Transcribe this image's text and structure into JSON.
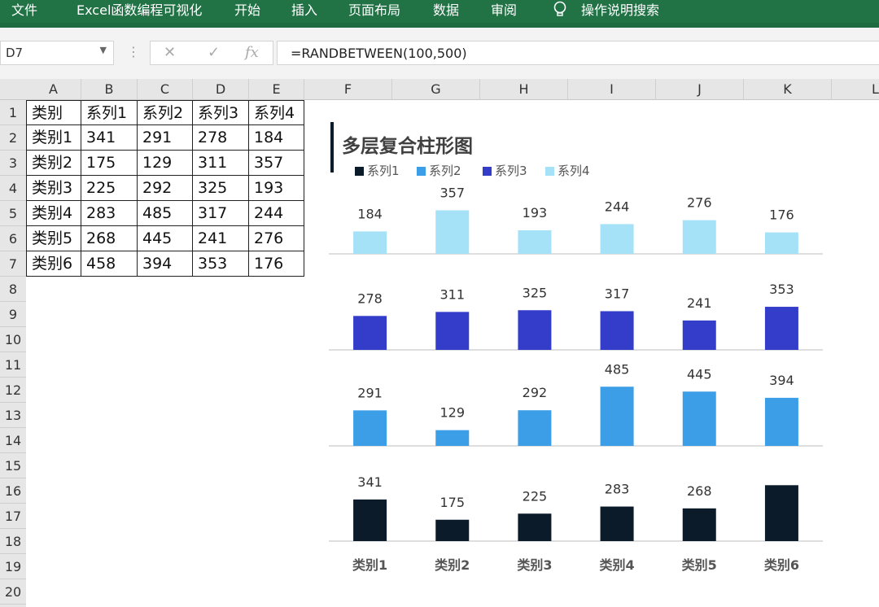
{
  "ribbon": {
    "tabs": [
      "文件",
      "Excel函数编程可视化",
      "开始",
      "插入",
      "页面布局",
      "数据",
      "审阅",
      "操作说明搜索"
    ]
  },
  "formula_bar": {
    "name_box": "D7",
    "cancel_icon": "✕",
    "enter_icon": "✓",
    "fx_label": "fx",
    "formula": "=RANDBETWEEN(100,500)"
  },
  "columns": [
    "A",
    "B",
    "C",
    "D",
    "E",
    "F",
    "G",
    "H",
    "I",
    "J",
    "K",
    "L"
  ],
  "rows": [
    "1",
    "2",
    "3",
    "4",
    "5",
    "6",
    "7",
    "8",
    "9",
    "10",
    "11",
    "12",
    "13",
    "14",
    "15",
    "16",
    "17",
    "18",
    "19",
    "20"
  ],
  "table": {
    "header": [
      "类别",
      "系列1",
      "系列2",
      "系列3",
      "系列4"
    ],
    "rows": [
      [
        "类别1",
        "341",
        "291",
        "278",
        "184"
      ],
      [
        "类别2",
        "175",
        "129",
        "311",
        "357"
      ],
      [
        "类别3",
        "225",
        "292",
        "325",
        "193"
      ],
      [
        "类别4",
        "283",
        "485",
        "317",
        "244"
      ],
      [
        "类别5",
        "268",
        "445",
        "241",
        "276"
      ],
      [
        "类别6",
        "458",
        "394",
        "353",
        "176"
      ]
    ]
  },
  "chart_data": {
    "type": "bar",
    "title": "多层复合柱形图",
    "categories": [
      "类别1",
      "类别2",
      "类别3",
      "类别4",
      "类别5",
      "类别6"
    ],
    "series": [
      {
        "name": "系列1",
        "color": "#0c1b2a",
        "values": [
          341,
          175,
          225,
          283,
          268,
          458
        ],
        "labels": [
          "341",
          "175",
          "225",
          "283",
          "268",
          ""
        ]
      },
      {
        "name": "系列2",
        "color": "#3d9ee8",
        "values": [
          291,
          129,
          292,
          485,
          445,
          394
        ],
        "labels": [
          "291",
          "129",
          "292",
          "485",
          "445",
          "394"
        ]
      },
      {
        "name": "系列3",
        "color": "#343dc9",
        "values": [
          278,
          311,
          325,
          317,
          241,
          353
        ],
        "labels": [
          "278",
          "311",
          "325",
          "317",
          "241",
          "353"
        ]
      },
      {
        "name": "系列4",
        "color": "#a6e2f7",
        "values": [
          184,
          357,
          193,
          244,
          276,
          176
        ],
        "labels": [
          "184",
          "357",
          "193",
          "244",
          "276",
          "176"
        ]
      }
    ],
    "layout": "stacked-panels",
    "legend": "top-left",
    "grid": false
  }
}
